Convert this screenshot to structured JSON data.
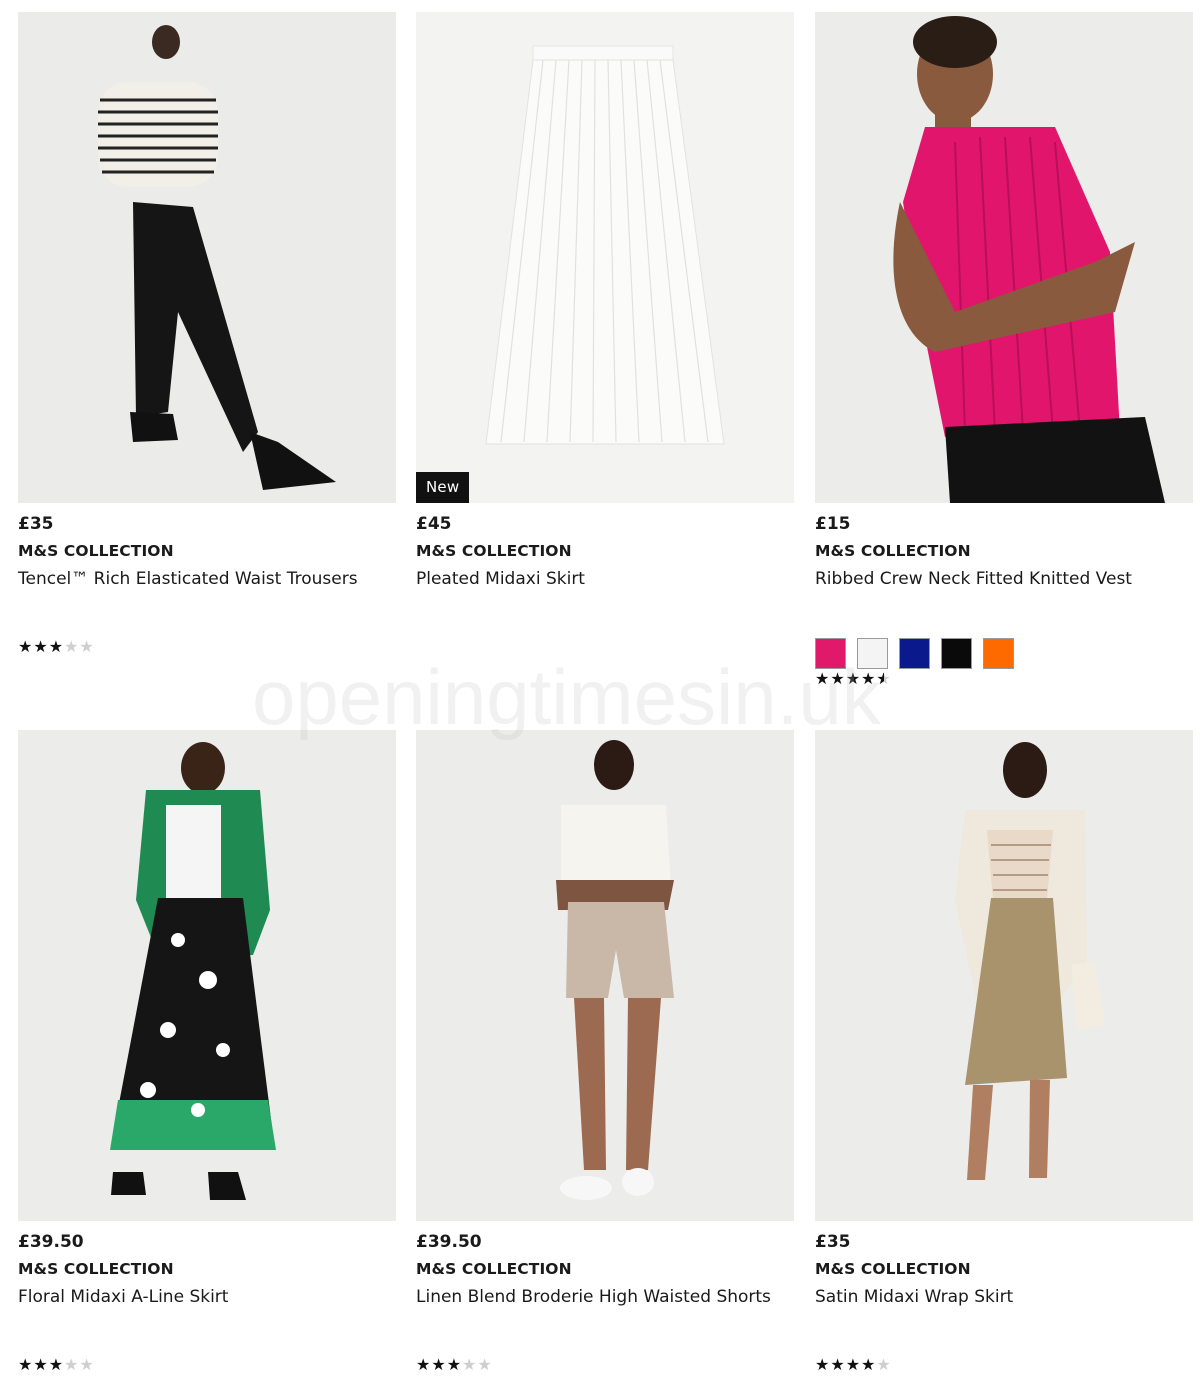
{
  "products": [
    {
      "price": "£35",
      "brand": "M&S COLLECTION",
      "title": "Tencel™ Rich Elasticated Waist Trousers",
      "rating": 3,
      "badge": "",
      "swatches": []
    },
    {
      "price": "£45",
      "brand": "M&S COLLECTION",
      "title": "Pleated Midaxi Skirt",
      "rating": null,
      "badge": "New",
      "swatches": []
    },
    {
      "price": "£15",
      "brand": "M&S COLLECTION",
      "title": "Ribbed Crew Neck Fitted Knitted Vest",
      "rating": 4.5,
      "badge": "",
      "swatches": [
        "#e0196a",
        "#f4f4f4",
        "#0a1a8c",
        "#0a0a0a",
        "#ff6a00"
      ]
    },
    {
      "price": "£39.50",
      "brand": "M&S COLLECTION",
      "title": "Floral Midaxi A-Line Skirt",
      "rating": 3,
      "badge": "",
      "swatches": []
    },
    {
      "price": "£39.50",
      "brand": "M&S COLLECTION",
      "title": "Linen Blend Broderie High Waisted Shorts",
      "rating": 3,
      "badge": "",
      "swatches": []
    },
    {
      "price": "£35",
      "brand": "M&S COLLECTION",
      "title": "Satin Midaxi Wrap Skirt",
      "rating": 4,
      "badge": "",
      "swatches": []
    }
  ],
  "watermark": "openingtimesin.uk"
}
